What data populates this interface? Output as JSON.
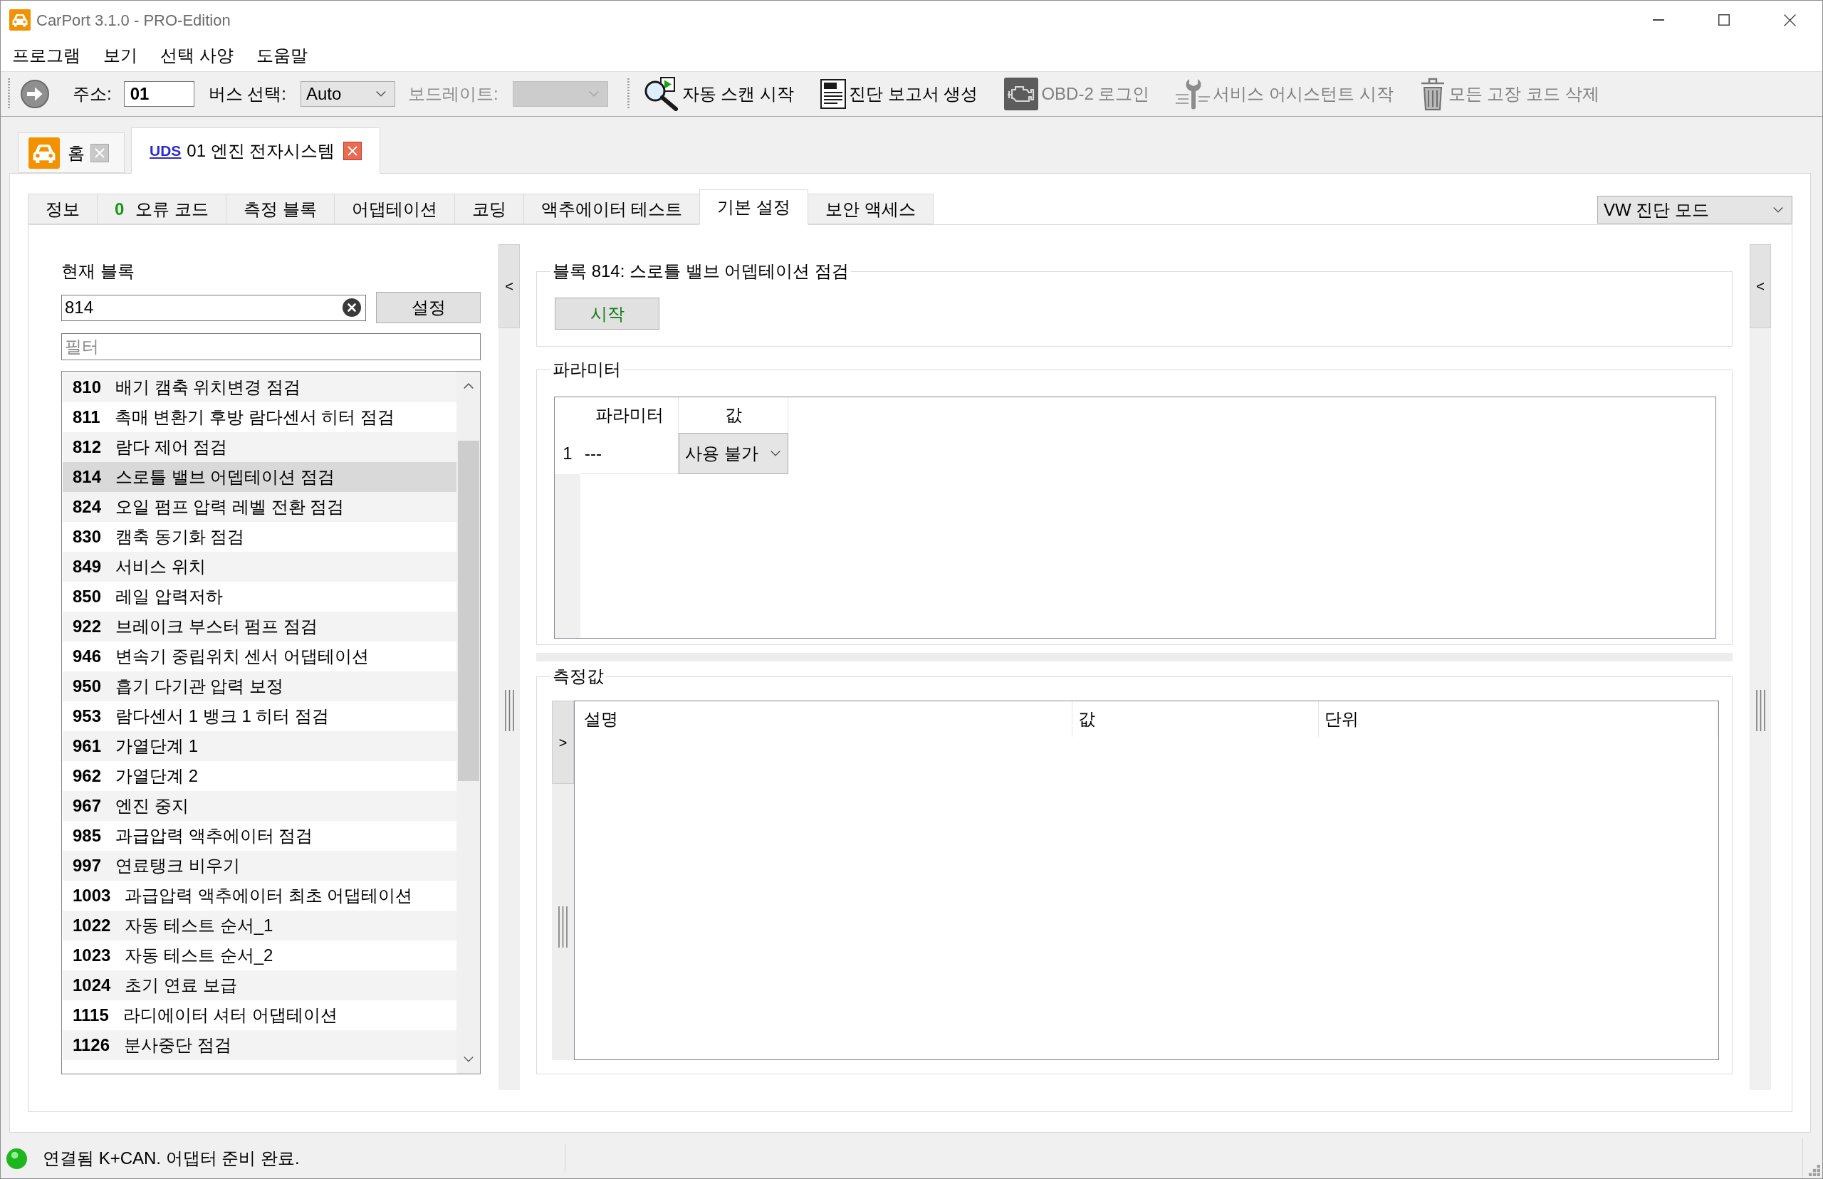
{
  "window": {
    "title": "CarPort 3.1.0 - PRO-Edition"
  },
  "menu": [
    {
      "label": "프로그램"
    },
    {
      "label": "보기"
    },
    {
      "label": "선택 사양"
    },
    {
      "label": "도움말"
    }
  ],
  "toolbar": {
    "address": {
      "label": "주소:",
      "value": "01"
    },
    "bus": {
      "label": "버스 선택:",
      "value": "Auto"
    },
    "baudrate": {
      "label": "보드레이트:",
      "disabled": true
    },
    "actions": [
      {
        "kind": "scan",
        "label": "자동 스캔 시작",
        "disabled": false
      },
      {
        "kind": "report",
        "label": "진단 보고서 생성",
        "disabled": false
      },
      {
        "kind": "engine",
        "label": "OBD-2 로그인",
        "disabled": true
      },
      {
        "kind": "service",
        "label": "서비스 어시스턴트 시작",
        "disabled": true
      },
      {
        "kind": "erase",
        "label": "모든 고장 코드 삭제",
        "disabled": true
      }
    ]
  },
  "doc_tabs": [
    {
      "kind": "home",
      "label": "홈",
      "selected": false
    },
    {
      "kind": "module",
      "protocol": "UDS",
      "label": "01 엔진 전자시스템",
      "selected": true
    }
  ],
  "tabs": [
    {
      "label": "정보",
      "selected": false
    },
    {
      "count": "0",
      "label": "오류 코드",
      "selected": false
    },
    {
      "label": "측정 블록",
      "selected": false
    },
    {
      "label": "어댑테이션",
      "selected": false
    },
    {
      "label": "코딩",
      "selected": false
    },
    {
      "label": "액추에이터 테스트",
      "selected": false
    },
    {
      "label": "기본 설정",
      "selected": true
    },
    {
      "label": "보안 액세스",
      "selected": false
    }
  ],
  "mode_select": {
    "value": "VW 진단 모드"
  },
  "current_block": {
    "label": "현재 블록",
    "value": "814",
    "button": "설정",
    "filter_placeholder": "필터"
  },
  "blocks": [
    {
      "number": "810",
      "name": "배기 캠축 위치변경 점검",
      "selected": false
    },
    {
      "number": "811",
      "name": "촉매 변환기 후방 람다센서 히터 점검",
      "selected": false
    },
    {
      "number": "812",
      "name": "람다 제어 점검",
      "selected": false
    },
    {
      "number": "814",
      "name": "스로틀 밸브 어뎁테이션 점검",
      "selected": true
    },
    {
      "number": "824",
      "name": "오일 펌프 압력 레벨 전환 점검",
      "selected": false
    },
    {
      "number": "830",
      "name": "캠축 동기화 점검",
      "selected": false
    },
    {
      "number": "849",
      "name": "서비스 위치",
      "selected": false
    },
    {
      "number": "850",
      "name": "레일 압력저하",
      "selected": false
    },
    {
      "number": "922",
      "name": "브레이크 부스터 펌프 점검",
      "selected": false
    },
    {
      "number": "946",
      "name": "변속기 중립위치 센서 어댑테이션",
      "selected": false
    },
    {
      "number": "950",
      "name": "흡기 다기관 압력 보정",
      "selected": false
    },
    {
      "number": "953",
      "name": "람다센서 1 뱅크 1 히터 점검",
      "selected": false
    },
    {
      "number": "961",
      "name": "가열단계 1",
      "selected": false
    },
    {
      "number": "962",
      "name": "가열단계 2",
      "selected": false
    },
    {
      "number": "967",
      "name": "엔진 중지",
      "selected": false
    },
    {
      "number": "985",
      "name": "과급압력 액추에이터 점검",
      "selected": false
    },
    {
      "number": "997",
      "name": "연료탱크 비우기",
      "selected": false
    },
    {
      "number": "1003",
      "name": "과급압력 액추에이터 최초 어댑테이션",
      "selected": false
    },
    {
      "number": "1022",
      "name": "자동 테스트 순서_1",
      "selected": false
    },
    {
      "number": "1023",
      "name": "자동 테스트 순서_2",
      "selected": false
    },
    {
      "number": "1024",
      "name": "초기 연료 보급",
      "selected": false
    },
    {
      "number": "1115",
      "name": "라디에이터 셔터 어댑테이션",
      "selected": false
    },
    {
      "number": "1126",
      "name": "분사중단 점검",
      "selected": false
    }
  ],
  "left_splitter": {
    "button": "<"
  },
  "basic_setting": {
    "title": "블록 814: 스로틀 밸브 어뎁테이션 점검",
    "button": "시작"
  },
  "parameters": {
    "title": "파라미터",
    "columns": [
      "파라미터",
      "값"
    ],
    "rows": [
      {
        "index": "1",
        "name": "---",
        "value": "사용 불가"
      }
    ]
  },
  "measurements": {
    "title": "측정값",
    "toggle": ">",
    "columns": [
      "설명",
      "값",
      "단위"
    ]
  },
  "right_splitter": {
    "button": "<"
  },
  "status_bar": {
    "connected": true,
    "text": "연결됨 K+CAN. 어댑터 준비 완료."
  }
}
